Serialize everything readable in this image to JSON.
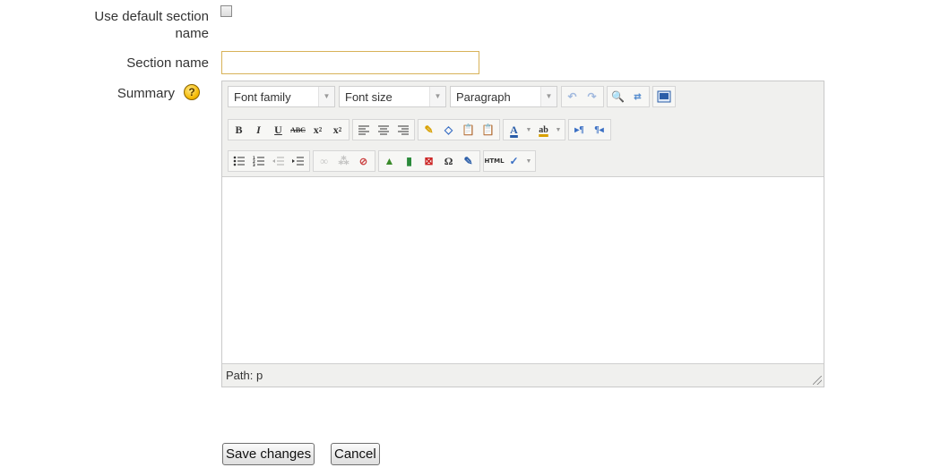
{
  "form": {
    "use_default_label_line1": "Use default section",
    "use_default_label_line2": "name",
    "section_name_label": "Section name",
    "section_name_value": "",
    "summary_label": "Summary",
    "help_glyph": "?"
  },
  "editor": {
    "font_family": "Font family",
    "font_size": "Font size",
    "paragraph": "Paragraph",
    "path_text": "Path: p",
    "format_buttons": [
      "B",
      "I",
      "U",
      "ABC",
      "X₂",
      "X²"
    ],
    "html_label": "HTML"
  },
  "buttons": {
    "save": "Save changes",
    "cancel": "Cancel"
  },
  "colors": {
    "input_border": "#d8b258",
    "toolbar_bg": "#f0f0ee",
    "help_icon": "#f5b800"
  }
}
